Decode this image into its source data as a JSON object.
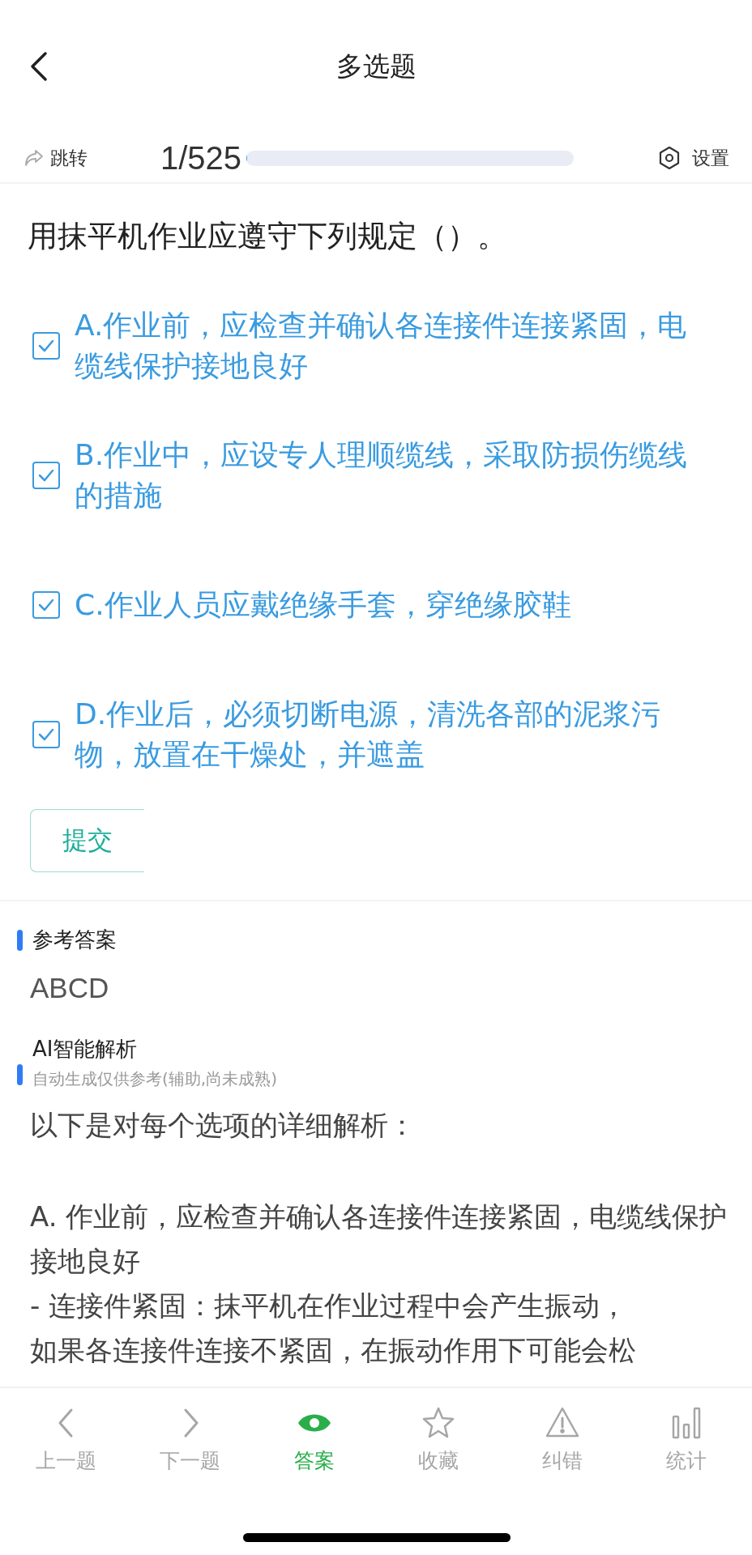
{
  "header": {
    "title": "多选题"
  },
  "toolbar": {
    "jump": "跳转",
    "counter": "1/525",
    "progress": {
      "level": 0.002
    },
    "settings": "设置"
  },
  "question": "用抹平机作业应遵守下列规定（）。",
  "options": [
    {
      "text": "A.作业前，应检查并确认各连接件连接紧固，电缆线保护接地良好",
      "checked": true
    },
    {
      "text": "B.作业中，应设专人理顺缆线，采取防损伤缆线的措施",
      "checked": true
    },
    {
      "text": "C.作业人员应戴绝缘手套，穿绝缘胶鞋",
      "checked": true
    },
    {
      "text": "D.作业后，必须切断电源，清洗各部的泥浆污物，放置在干燥处，并遮盖",
      "checked": true
    }
  ],
  "submit": "提交",
  "answer": {
    "heading": "参考答案",
    "value": "ABCD"
  },
  "analysis": {
    "heading": "AI智能解析",
    "subtitle": "自动生成仅供参考(辅助,尚未成熟)",
    "paragraphs": [
      "以下是对每个选项的详细解析：",
      "A. 作业前，应检查并确认各连接件连接紧固，电缆线保护接地良好",
      "- 连接件紧固：抹平机在作业过程中会产生振动，",
      "如果各连接件连接不紧固，在振动作用下可能会松"
    ]
  },
  "tabbar": [
    {
      "kind": "prev",
      "label": "上一题",
      "selected": false
    },
    {
      "kind": "next",
      "label": "下一题",
      "selected": false
    },
    {
      "kind": "eye",
      "label": "答案",
      "selected": true
    },
    {
      "kind": "star",
      "label": "收藏",
      "selected": false
    },
    {
      "kind": "warning",
      "label": "纠错",
      "selected": false
    },
    {
      "kind": "stats",
      "label": "统计",
      "selected": false
    }
  ]
}
